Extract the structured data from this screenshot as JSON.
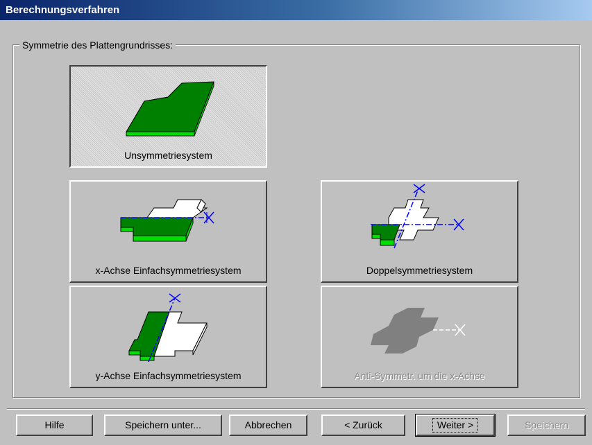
{
  "window": {
    "title": "Berechnungsverfahren"
  },
  "group": {
    "label": "Symmetrie des Plattengrundrisses:"
  },
  "options": [
    {
      "label": "Unsymmetriesystem",
      "selected": true,
      "enabled": true
    },
    {
      "label": "x-Achse Einfachsymmetriesystem",
      "selected": false,
      "enabled": true
    },
    {
      "label": "Doppelsymmetriesystem",
      "selected": false,
      "enabled": true
    },
    {
      "label": "y-Achse Einfachsymmetriesystem",
      "selected": false,
      "enabled": true
    },
    {
      "label": "Anti-Symmetr. um die x-Achse",
      "selected": false,
      "enabled": false
    }
  ],
  "buttons": {
    "help": "Hilfe",
    "save_as": "Speichern unter...",
    "cancel": "Abbrechen",
    "back": "< Zurück",
    "next": "Weiter >",
    "save": "Speichern"
  },
  "colors": {
    "plate_fill": "#008000",
    "plate_edge": "#00e000",
    "axis": "#0000ff",
    "disabled_fill": "#808080"
  }
}
